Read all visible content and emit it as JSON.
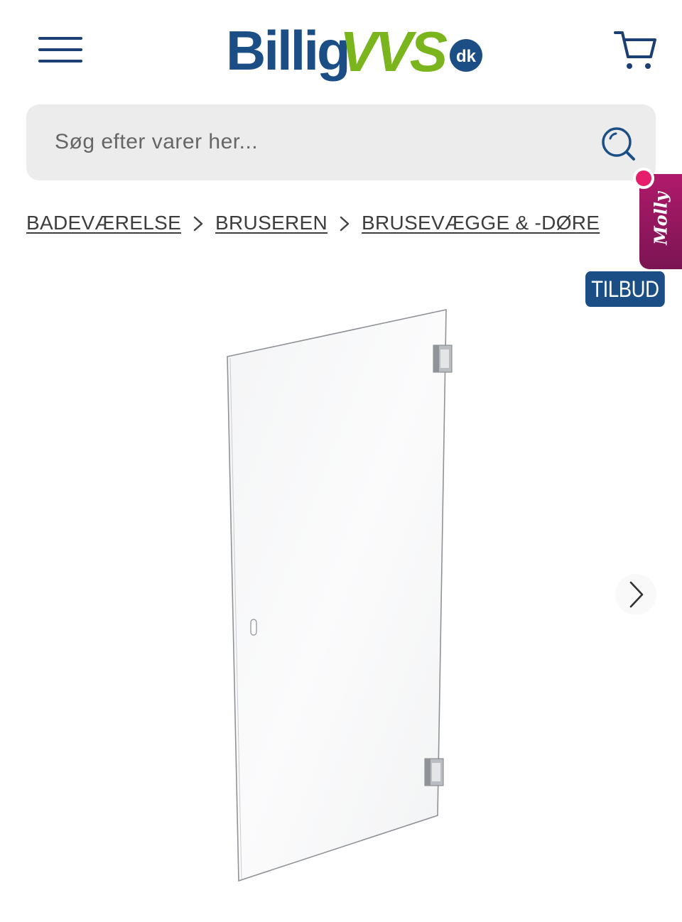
{
  "header": {
    "logo": {
      "text_main": "Billig",
      "text_accent": "VVS",
      "badge": "dk"
    },
    "menu_icon": "hamburger-menu-icon",
    "cart_icon": "shopping-cart-icon"
  },
  "search": {
    "placeholder": "Søg efter varer her...",
    "icon": "search-icon"
  },
  "breadcrumb": {
    "items": [
      {
        "label": "BADEVÆRELSE"
      },
      {
        "label": "BRUSEREN"
      },
      {
        "label": "BRUSEVÆGGE & -DØRE"
      }
    ],
    "separator_icon": "chevron-right-icon"
  },
  "chat_widget": {
    "label": "Molly"
  },
  "badge": {
    "label": "TILBUD"
  },
  "product_image": {
    "subject": "glass-shower-door",
    "next_icon": "chevron-right-icon"
  },
  "colors": {
    "brand_blue": "#1c4e86",
    "brand_green": "#7ab51d",
    "widget_magenta": "#9a1760",
    "search_bg": "#ececec"
  }
}
